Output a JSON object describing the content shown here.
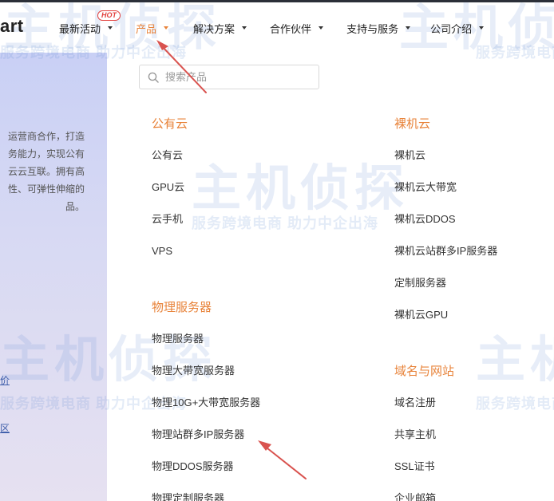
{
  "brand": {
    "logo_text": "art"
  },
  "nav": {
    "items": [
      {
        "label": "最新活动",
        "badge": "HOT"
      },
      {
        "label": "产品",
        "active": true
      },
      {
        "label": "解决方案"
      },
      {
        "label": "合作伙伴"
      },
      {
        "label": "支持与服务"
      },
      {
        "label": "公司介绍"
      }
    ]
  },
  "search": {
    "placeholder": "搜索产品",
    "value": ""
  },
  "left_panel": {
    "text_lines": [
      "运营商合作，打造",
      "务能力，实现公有",
      "云云互联。拥有高",
      "性、可弹性伸缩的",
      "品。"
    ],
    "link_1": "价",
    "link_2": "区"
  },
  "menu": {
    "col1": [
      {
        "title": "公有云",
        "items": [
          "公有云",
          "GPU云",
          "云手机",
          "VPS"
        ]
      },
      {
        "title": "物理服务器",
        "items": [
          "物理服务器",
          "物理大带宽服务器",
          "物理10G+大带宽服务器",
          "物理站群多IP服务器",
          "物理DDOS服务器",
          "物理定制服务器"
        ]
      }
    ],
    "col2": [
      {
        "title": "裸机云",
        "items": [
          "裸机云",
          "裸机云大带宽",
          "裸机云DDOS",
          "裸机云站群多IP服务器",
          "定制服务器",
          "裸机云GPU"
        ]
      },
      {
        "title": "域名与网站",
        "items": [
          "域名注册",
          "共享主机",
          "SSL证书",
          "企业邮箱"
        ]
      }
    ]
  },
  "watermark": {
    "brand": "主机侦探",
    "slogan": "服务跨境电商 助力中企出海",
    "slogan_short": "服务跨境电商"
  },
  "colors": {
    "accent": "#e8833a",
    "hot": "#e2403d",
    "arrow": "#d9534f",
    "panel_top": "#c9d0f5",
    "panel_bottom": "#e6e1f1"
  }
}
